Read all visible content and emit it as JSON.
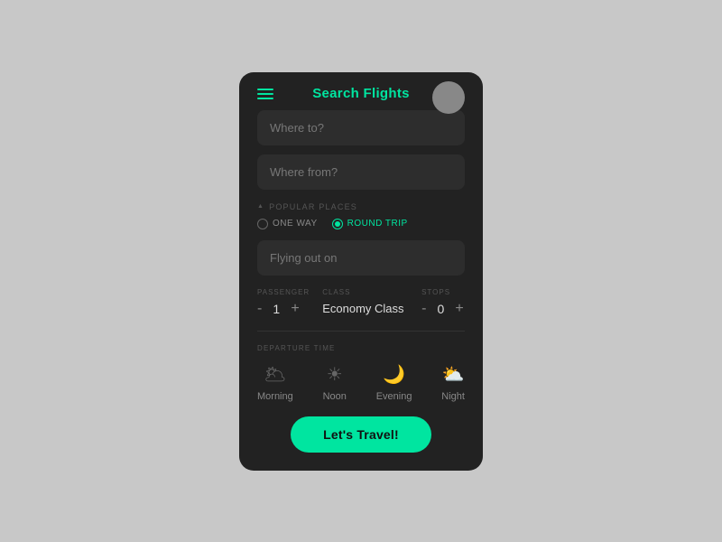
{
  "header": {
    "title": "Search Flights"
  },
  "inputs": {
    "where_to_placeholder": "Where to?",
    "where_from_placeholder": "Where from?",
    "flying_out_placeholder": "Flying out on"
  },
  "popular_places_label": "POPULAR PLACES",
  "trip_types": [
    {
      "id": "one-way",
      "label": "ONE WAY",
      "active": false
    },
    {
      "id": "round-trip",
      "label": "ROUND TRIP",
      "active": true
    }
  ],
  "passenger": {
    "label": "PASSENGER",
    "value": "1",
    "minus": "-",
    "plus": "+"
  },
  "class": {
    "label": "CLASS",
    "value": "Economy Class"
  },
  "stops": {
    "label": "STOPS",
    "value": "0",
    "minus": "-",
    "plus": "+"
  },
  "departure_time": {
    "label": "DEPARTURE TIME",
    "options": [
      {
        "id": "morning",
        "label": "Morning",
        "icon": "🌥"
      },
      {
        "id": "noon",
        "label": "Noon",
        "icon": "☀"
      },
      {
        "id": "evening",
        "label": "Evening",
        "icon": "🌙"
      },
      {
        "id": "night",
        "label": "Night",
        "icon": "⛅"
      }
    ]
  },
  "cta": {
    "label": "Let's Travel!"
  }
}
